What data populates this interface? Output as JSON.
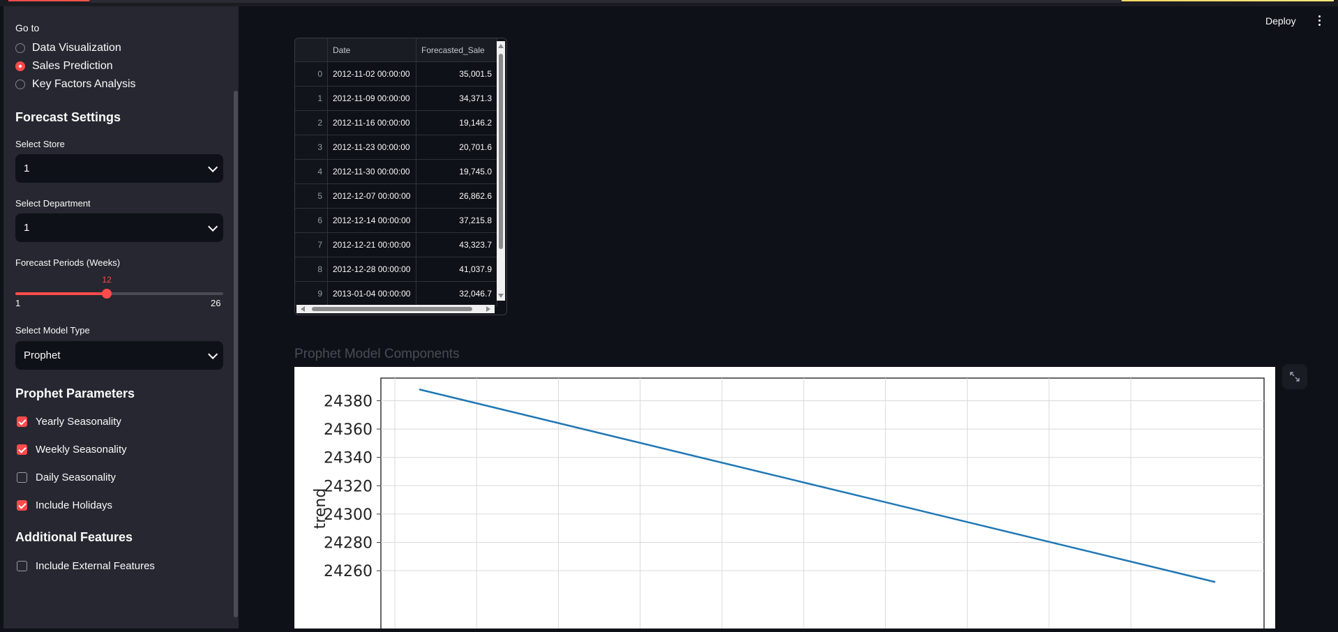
{
  "nav": {
    "label": "Go to",
    "options": [
      "Data Visualization",
      "Sales Prediction",
      "Key Factors Analysis"
    ],
    "selected": "Sales Prediction"
  },
  "forecast_settings": {
    "title": "Forecast Settings",
    "store_label": "Select Store",
    "store_value": "1",
    "dept_label": "Select Department",
    "dept_value": "1",
    "periods_label": "Forecast Periods (Weeks)",
    "periods_value": "12",
    "periods_min": "1",
    "periods_max": "26",
    "model_label": "Select Model Type",
    "model_value": "Prophet"
  },
  "prophet_params": {
    "title": "Prophet Parameters",
    "items": [
      {
        "label": "Yearly Seasonality",
        "checked": true
      },
      {
        "label": "Weekly Seasonality",
        "checked": true
      },
      {
        "label": "Daily Seasonality",
        "checked": false
      },
      {
        "label": "Include Holidays",
        "checked": true
      }
    ]
  },
  "additional": {
    "title": "Additional Features",
    "items": [
      {
        "label": "Include External Features",
        "checked": false
      }
    ]
  },
  "header": {
    "deploy": "Deploy"
  },
  "table": {
    "columns": [
      "",
      "Date",
      "Forecasted_Sale"
    ],
    "rows": [
      [
        "0",
        "2012-11-02 00:00:00",
        "35,001.5"
      ],
      [
        "1",
        "2012-11-09 00:00:00",
        "34,371.3"
      ],
      [
        "2",
        "2012-11-16 00:00:00",
        "19,146.2"
      ],
      [
        "3",
        "2012-11-23 00:00:00",
        "20,701.6"
      ],
      [
        "4",
        "2012-11-30 00:00:00",
        "19,745.0"
      ],
      [
        "5",
        "2012-12-07 00:00:00",
        "26,862.6"
      ],
      [
        "6",
        "2012-12-14 00:00:00",
        "37,215.8"
      ],
      [
        "7",
        "2012-12-21 00:00:00",
        "43,323.7"
      ],
      [
        "8",
        "2012-12-28 00:00:00",
        "41,037.9"
      ],
      [
        "9",
        "2013-01-04 00:00:00",
        "32,046.7"
      ]
    ]
  },
  "components_title": "Prophet Model Components",
  "chart_data": {
    "type": "line",
    "ylabel": "trend",
    "yticks": [
      24260,
      24280,
      24300,
      24320,
      24340,
      24360,
      24380
    ],
    "ylim": [
      24250,
      24396
    ],
    "xlim": [
      0,
      1
    ],
    "series": [
      {
        "x": [
          0,
          1
        ],
        "values": [
          24388,
          24252
        ]
      }
    ],
    "grid": true,
    "color": "#1f77b4"
  }
}
